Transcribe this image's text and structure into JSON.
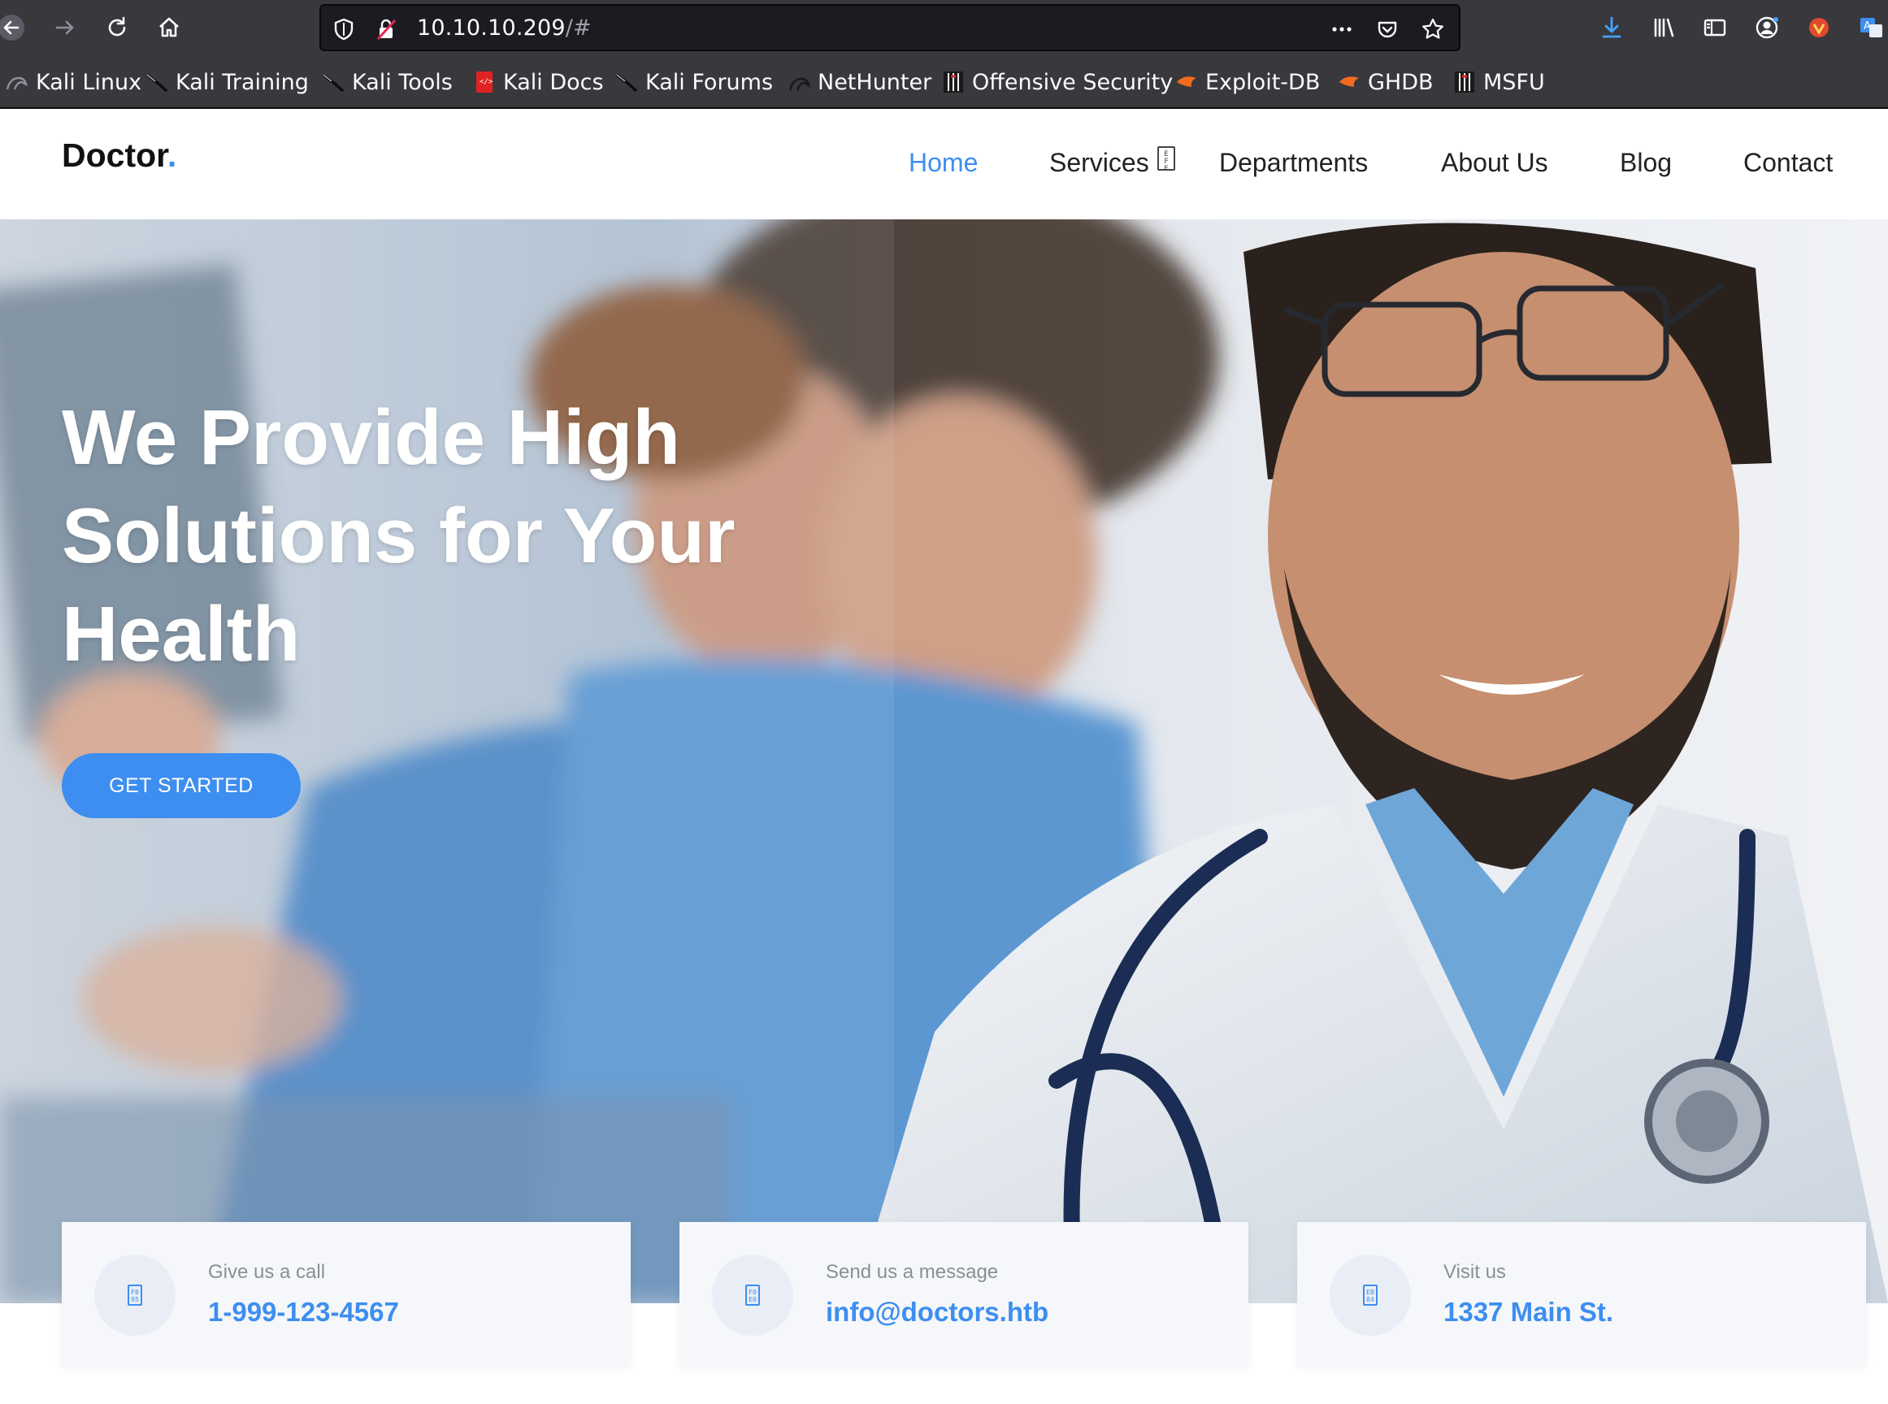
{
  "browser": {
    "url_host": "10.10.10.209",
    "url_path": "/#",
    "bookmarks": [
      {
        "label": "Kali Linux",
        "icon": "kali-dragon-icon"
      },
      {
        "label": "Kali Training",
        "icon": "kali-dragon-icon"
      },
      {
        "label": "Kali Tools",
        "icon": "kali-dragon-icon"
      },
      {
        "label": "Kali Docs",
        "icon": "kali-docs-icon"
      },
      {
        "label": "Kali Forums",
        "icon": "kali-dragon-icon"
      },
      {
        "label": "NetHunter",
        "icon": "nethunter-icon"
      },
      {
        "label": "Offensive Security",
        "icon": "offsec-icon"
      },
      {
        "label": "Exploit-DB",
        "icon": "exploitdb-icon"
      },
      {
        "label": "GHDB",
        "icon": "exploitdb-icon"
      },
      {
        "label": "MSFU",
        "icon": "offsec-icon"
      }
    ]
  },
  "site": {
    "logo_text": "Doctor",
    "logo_dot": ".",
    "nav": {
      "home": "Home",
      "services": "Services",
      "departments": "Departments",
      "about": "About Us",
      "blog": "Blog",
      "contact": "Contact"
    },
    "hero": {
      "title_line1": "We Provide High",
      "title_line2": "Solutions for Your",
      "title_line3": "Health",
      "cta": "GET STARTED"
    },
    "info": {
      "call_label": "Give us a call",
      "call_value": "1-999-123-4567",
      "message_label": "Send us a message",
      "message_value": "info@doctors.htb",
      "visit_label": "Visit us",
      "visit_value": "1337 Main St."
    }
  },
  "colors": {
    "accent": "#3d8ef0",
    "chrome": "#38383d",
    "urlbar": "#1c1b22"
  }
}
